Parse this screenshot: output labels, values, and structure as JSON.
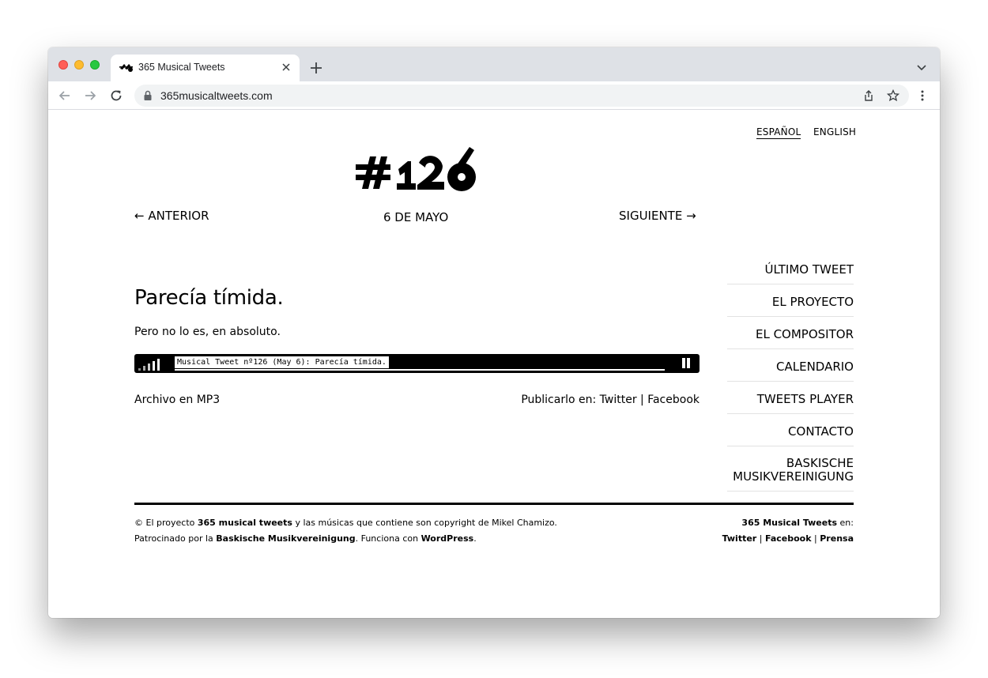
{
  "browser": {
    "tab_title": "365 Musical Tweets",
    "url": "365musicaltweets.com"
  },
  "lang": {
    "es": "ESPAÑOL",
    "en": "ENGLISH"
  },
  "logo_text": "#126",
  "nav": {
    "prev": "← ANTERIOR",
    "date": "6 DE MAYO",
    "next": "SIGUIENTE →"
  },
  "post": {
    "title": "Parecía tímida.",
    "text": "Pero no lo es, en absoluto."
  },
  "player": {
    "track_label": "Musical Tweet nº126 (May 6): Parecía tímida.",
    "progress": 0.0
  },
  "links": {
    "mp3": "Archivo en MP3",
    "share_prefix": "Publicarlo en:",
    "share_twitter": "Twitter",
    "sep": "|",
    "share_facebook": "Facebook"
  },
  "sidebar": {
    "items": [
      {
        "label": "ÚLTIMO TWEET"
      },
      {
        "label": "EL PROYECTO"
      },
      {
        "label": "EL COMPOSITOR"
      },
      {
        "label": "CALENDARIO"
      },
      {
        "label": "TWEETS PLAYER"
      },
      {
        "label": "CONTACTO"
      },
      {
        "label_line1": "BASKISCHE",
        "label_line2": "MUSIKVEREINIGUNG"
      }
    ]
  },
  "footer": {
    "line1_a": "© El proyecto ",
    "line1_b": "365 musical tweets",
    "line1_c": " y las músicas que contiene son copyright de Mikel Chamizo.",
    "line2_a": "Patrocinado por la ",
    "line2_b": "Baskische Musikvereinigung",
    "line2_c": ". Funciona con ",
    "line2_d": "WordPress",
    "line2_e": ".",
    "right_brand": "365 Musical Tweets",
    "right_suffix": " en:",
    "right_twitter": "Twitter",
    "right_facebook": "Facebook",
    "right_prensa": "Prensa",
    "sep": "|"
  },
  "colors": {
    "tabbar": "#dee1e6",
    "omnibox": "#f1f3f4",
    "ink": "#000000"
  }
}
